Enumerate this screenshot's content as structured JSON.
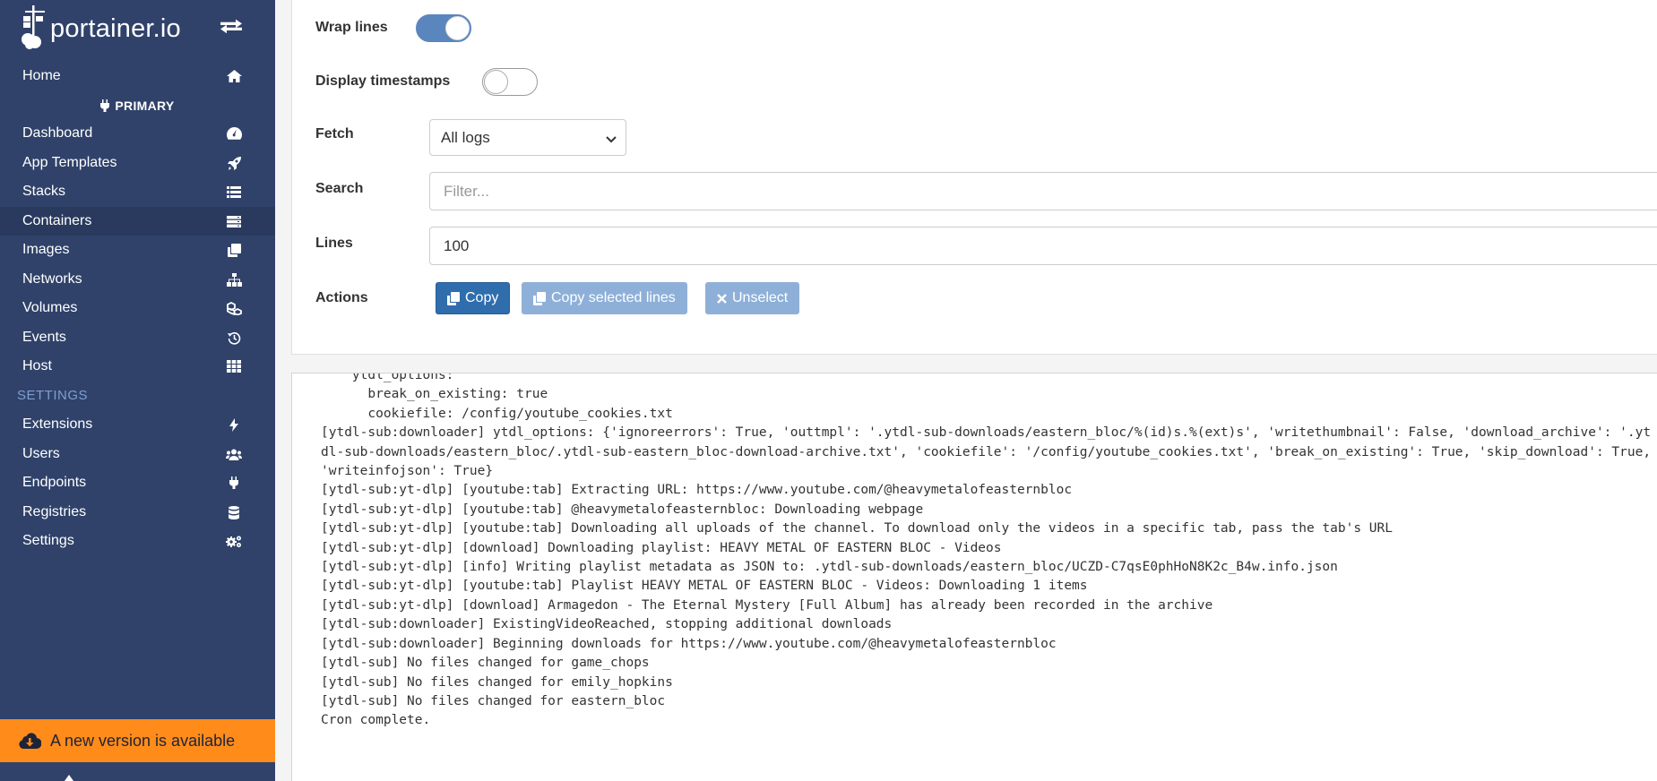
{
  "brand": {
    "name": "portainer.io",
    "logo_icon": "portainer-crane-logo",
    "toggle_icon": "arrows-swap-icon"
  },
  "sidebar": {
    "home": {
      "label": "Home",
      "icon": "home-icon"
    },
    "environment": {
      "label": "PRIMARY",
      "icon": "plug-icon"
    },
    "items": [
      {
        "label": "Dashboard",
        "icon": "tachometer-icon"
      },
      {
        "label": "App Templates",
        "icon": "rocket-icon"
      },
      {
        "label": "Stacks",
        "icon": "list-icon"
      },
      {
        "label": "Containers",
        "icon": "server-icon",
        "active": true
      },
      {
        "label": "Images",
        "icon": "clone-icon"
      },
      {
        "label": "Networks",
        "icon": "sitemap-icon"
      },
      {
        "label": "Volumes",
        "icon": "cubes-icon"
      },
      {
        "label": "Events",
        "icon": "history-icon"
      },
      {
        "label": "Host",
        "icon": "th-icon"
      }
    ],
    "settings_header": "SETTINGS",
    "settings_items": [
      {
        "label": "Extensions",
        "icon": "bolt-icon"
      },
      {
        "label": "Users",
        "icon": "users-icon"
      },
      {
        "label": "Endpoints",
        "icon": "plug-icon"
      },
      {
        "label": "Registries",
        "icon": "database-icon"
      },
      {
        "label": "Settings",
        "icon": "cogs-icon"
      }
    ],
    "update_banner": "A new version is available"
  },
  "form": {
    "wrap_lines": {
      "label": "Wrap lines",
      "checked": true
    },
    "display_timestamps": {
      "label": "Display timestamps",
      "checked": false
    },
    "fetch": {
      "label": "Fetch",
      "value": "All logs"
    },
    "search": {
      "label": "Search",
      "placeholder": "Filter...",
      "value": ""
    },
    "lines": {
      "label": "Lines",
      "value": "100"
    },
    "actions": {
      "label": "Actions",
      "copy": "Copy",
      "copy_selected": "Copy selected lines",
      "unselect": "Unselect"
    }
  },
  "colors": {
    "sidebar_bg": "#30426a",
    "accent": "#2f6dad",
    "banner": "#ff8c1a",
    "settings_header": "#7e9fcf"
  },
  "log": {
    "lines": [
      "    ytdl_options:",
      "      break_on_existing: true",
      "      cookiefile: /config/youtube_cookies.txt",
      "[ytdl-sub:downloader] ytdl_options: {'ignoreerrors': True, 'outtmpl': '.ytdl-sub-downloads/eastern_bloc/%(id)s.%(ext)s', 'writethumbnail': False, 'download_archive': '.ytdl-sub-downloads/eastern_bloc/.ytdl-sub-eastern_bloc-download-archive.txt', 'cookiefile': '/config/youtube_cookies.txt', 'break_on_existing': True, 'skip_download': True, 'writeinfojson': True}",
      "[ytdl-sub:yt-dlp] [youtube:tab] Extracting URL: https://www.youtube.com/@heavymetalofeasternbloc",
      "[ytdl-sub:yt-dlp] [youtube:tab] @heavymetalofeasternbloc: Downloading webpage",
      "[ytdl-sub:yt-dlp] [youtube:tab] Downloading all uploads of the channel. To download only the videos in a specific tab, pass the tab's URL",
      "[ytdl-sub:yt-dlp] [download] Downloading playlist: HEAVY METAL OF EASTERN BLOC - Videos",
      "[ytdl-sub:yt-dlp] [info] Writing playlist metadata as JSON to: .ytdl-sub-downloads/eastern_bloc/UCZD-C7qsE0phHoN8K2c_B4w.info.json",
      "[ytdl-sub:yt-dlp] [youtube:tab] Playlist HEAVY METAL OF EASTERN BLOC - Videos: Downloading 1 items",
      "[ytdl-sub:yt-dlp] [download] Armagedon - The Eternal Mystery [Full Album] has already been recorded in the archive",
      "[ytdl-sub:downloader] ExistingVideoReached, stopping additional downloads",
      "[ytdl-sub:downloader] Beginning downloads for https://www.youtube.com/@heavymetalofeasternbloc",
      "[ytdl-sub] No files changed for game_chops",
      "[ytdl-sub] No files changed for emily_hopkins",
      "[ytdl-sub] No files changed for eastern_bloc",
      "Cron complete."
    ]
  }
}
